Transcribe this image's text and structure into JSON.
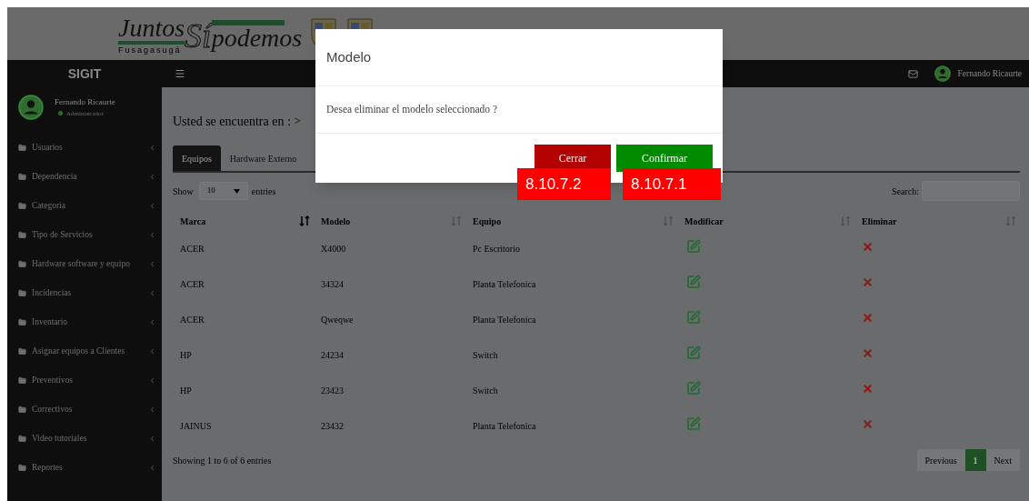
{
  "banner": {
    "logo": {
      "word1": "Juntos",
      "word2": "Sí",
      "word3": "podemos",
      "city": "Fusagasugá"
    }
  },
  "sidebar": {
    "brand": "SIGIT",
    "user": {
      "name": "Fernando Ricaurte",
      "role": "Administrador"
    },
    "items": [
      {
        "label": "Usuarios"
      },
      {
        "label": "Dependencia"
      },
      {
        "label": "Categoria"
      },
      {
        "label": "Tipo de Servicios"
      },
      {
        "label": "Hardware software y equipo"
      },
      {
        "label": "Incidencias"
      },
      {
        "label": "Inventario"
      },
      {
        "label": "Asignar equipos a Clientes"
      },
      {
        "label": "Preventivos"
      },
      {
        "label": "Correctivos"
      },
      {
        "label": "Video tutoriales"
      },
      {
        "label": "Reportes"
      }
    ]
  },
  "navbar": {
    "user_name": "Fernando Ricaurte"
  },
  "breadcrumb": {
    "label": "Usted se encuentra en :",
    "separator": ">"
  },
  "tabs": [
    {
      "label": "Equipos",
      "selected": true
    },
    {
      "label": "Hardware Externo",
      "selected": false
    }
  ],
  "table_controls": {
    "show_label": "Show",
    "page_size": "10",
    "entries_label": "entries",
    "search_label": "Search:"
  },
  "table": {
    "columns": [
      {
        "label": "Marca",
        "sorted": true
      },
      {
        "label": "Modelo",
        "sorted": false
      },
      {
        "label": "Equipo",
        "sorted": false
      },
      {
        "label": "Modificar",
        "sorted": false
      },
      {
        "label": "Eliminar",
        "sorted": false
      }
    ],
    "rows": [
      {
        "cells": [
          "ACER",
          "X4000",
          "Pc Escritorio"
        ]
      },
      {
        "cells": [
          "ACER",
          "34324",
          "Planta Telefonica"
        ]
      },
      {
        "cells": [
          "ACER",
          "Qweqwe",
          "Planta Telefonica"
        ]
      },
      {
        "cells": [
          "HP",
          "24234",
          "Switch"
        ]
      },
      {
        "cells": [
          "HP",
          "23423",
          "Switch"
        ]
      },
      {
        "cells": [
          "JAINUS",
          "23432",
          "Planta Telefonica"
        ]
      }
    ]
  },
  "footer": {
    "info": "Showing 1 to 6 of 6 entries",
    "pagination": [
      {
        "label": "Previous",
        "selected": false
      },
      {
        "label": "1",
        "selected": true
      },
      {
        "label": "Next",
        "selected": false
      }
    ]
  },
  "dialog": {
    "title": "Modelo",
    "message": "Desea eliminar el modelo seleccionado ?",
    "buttons": [
      {
        "label": "Cerrar",
        "kind": "cancel"
      },
      {
        "label": "Confirmar",
        "kind": "confirm"
      }
    ]
  },
  "annotations": [
    {
      "label": "8.10.7.2"
    },
    {
      "label": "8.10.7.1"
    }
  ]
}
